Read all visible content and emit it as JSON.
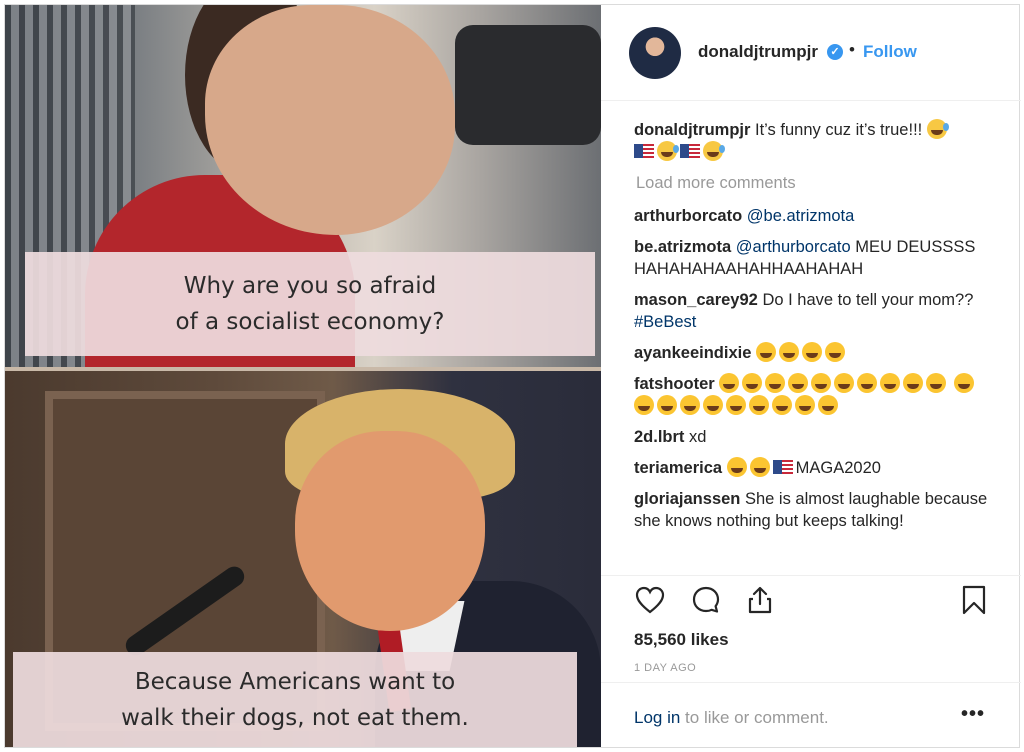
{
  "media": {
    "top_caption": "Why are you so afraid\nof a socialist economy?",
    "bottom_caption": "Because Americans want to\nwalk their dogs, not eat them."
  },
  "header": {
    "username": "donaldjtrumpjr",
    "verified_icon": "verified-badge-icon",
    "separator": "•",
    "follow_label": "Follow"
  },
  "caption": {
    "username": "donaldjtrumpjr",
    "text": "It’s funny cuz it’s true!!!"
  },
  "load_more_label": "Load more comments",
  "comments": [
    {
      "user": "arthurborcato",
      "mention": "@be.atrizmota",
      "text": ""
    },
    {
      "user": "be.atrizmota",
      "mention": "@arthurborcato",
      "text": "MEU DEUSSSS HAHAHAHAAHAHHAAHAHAH"
    },
    {
      "user": "mason_carey92",
      "text": "Do I have to tell your mom??",
      "hashtag": "#BeBest"
    },
    {
      "user": "ayankeeindixie",
      "text": ""
    },
    {
      "user": "fatshooter",
      "text": ""
    },
    {
      "user": "2d.lbrt",
      "text": "xd"
    },
    {
      "user": "teriamerica",
      "text": "MAGA2020"
    },
    {
      "user": "gloriajanssen",
      "text": "She is almost laughable because she knows nothing but keeps talking!"
    }
  ],
  "actions": {
    "like_icon": "heart-icon",
    "comment_icon": "comment-icon",
    "share_icon": "share-icon",
    "save_icon": "bookmark-icon",
    "likes": "85,560 likes",
    "timestamp": "1 DAY AGO"
  },
  "footer": {
    "login_link": "Log in",
    "login_text": " to like or comment.",
    "more_label": "•••"
  },
  "colors": {
    "link_blue": "#3897f0",
    "username_dark": "#262626",
    "mention": "#003569",
    "muted": "#999999"
  }
}
